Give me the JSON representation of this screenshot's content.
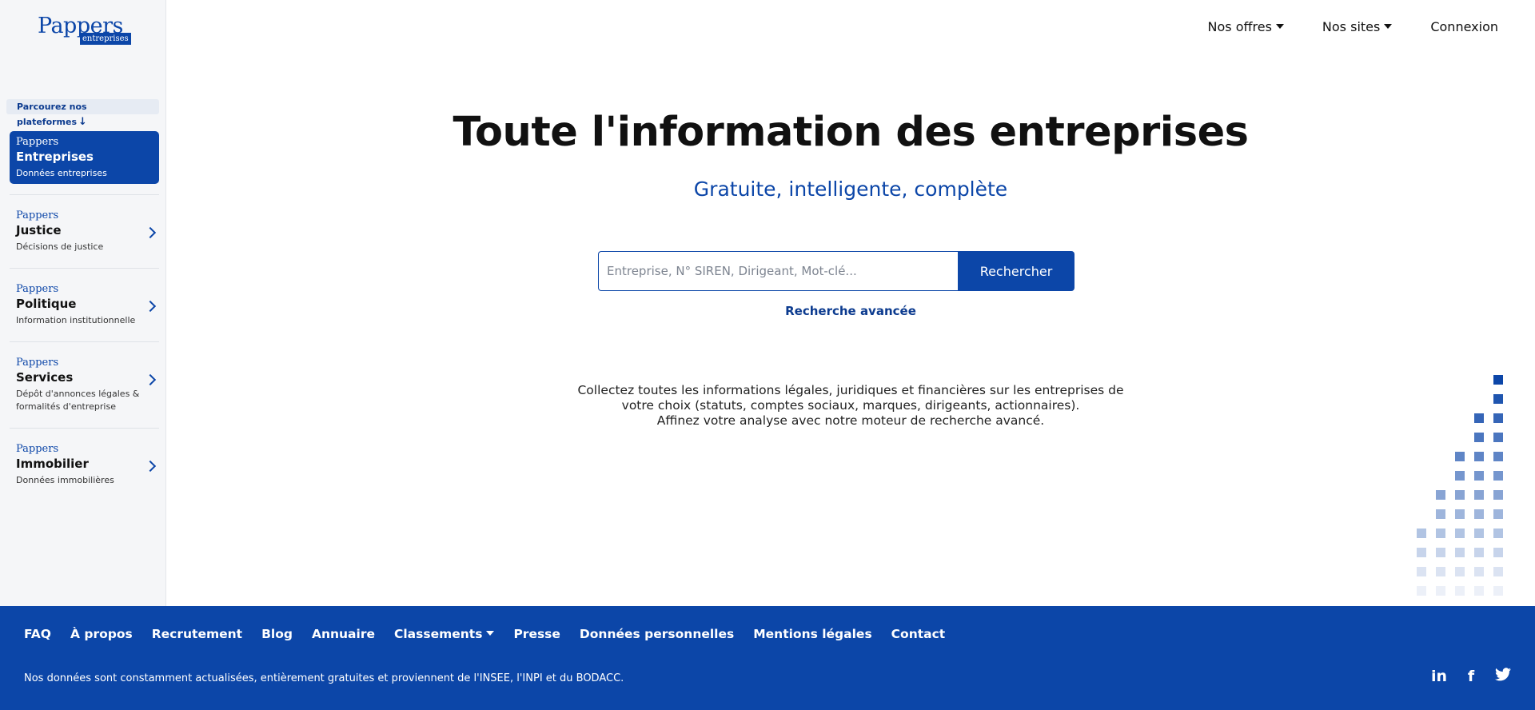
{
  "logo": {
    "main": "Pappers",
    "sub": "entreprises"
  },
  "sidebar": {
    "browse_label": "Parcourez nos plateformes",
    "platforms": [
      {
        "brand": "Pappers",
        "name": "Entreprises",
        "desc": "Données entreprises",
        "active": true
      },
      {
        "brand": "Pappers",
        "name": "Justice",
        "desc": "Décisions de justice"
      },
      {
        "brand": "Pappers",
        "name": "Politique",
        "desc": "Information institutionnelle"
      },
      {
        "brand": "Pappers",
        "name": "Services",
        "desc": "Dépôt d'annonces légales & formalités d'entreprise"
      },
      {
        "brand": "Pappers",
        "name": "Immobilier",
        "desc": "Données immobilières"
      }
    ]
  },
  "topnav": {
    "offers": "Nos offres",
    "sites": "Nos sites",
    "login": "Connexion"
  },
  "hero": {
    "title": "Toute l'information des entreprises",
    "subtitle": "Gratuite, intelligente, complète",
    "search_placeholder": "Entreprise, N° SIREN, Dirigeant, Mot-clé...",
    "search_value": "",
    "search_button": "Rechercher",
    "advanced": "Recherche avancée",
    "desc_line1": "Collectez toutes les informations légales, juridiques et financières sur les entreprises de",
    "desc_line2": "votre choix (statuts, comptes sociaux, marques, dirigeants, actionnaires).",
    "desc_line3": "Affinez votre analyse avec notre moteur de recherche avancé."
  },
  "footer": {
    "links": [
      "FAQ",
      "À propos",
      "Recrutement",
      "Blog",
      "Annuaire",
      "Classements",
      "Presse",
      "Données personnelles",
      "Mentions légales",
      "Contact"
    ],
    "note": "Nos données sont constamment actualisées, entièrement gratuites et proviennent de l'INSEE, l'INPI et du BODACC.",
    "social": [
      "linkedin-icon",
      "facebook-icon",
      "twitter-icon"
    ]
  },
  "colors": {
    "brand": "#0c46a8",
    "sidebar_bg": "#f5f6f8"
  }
}
